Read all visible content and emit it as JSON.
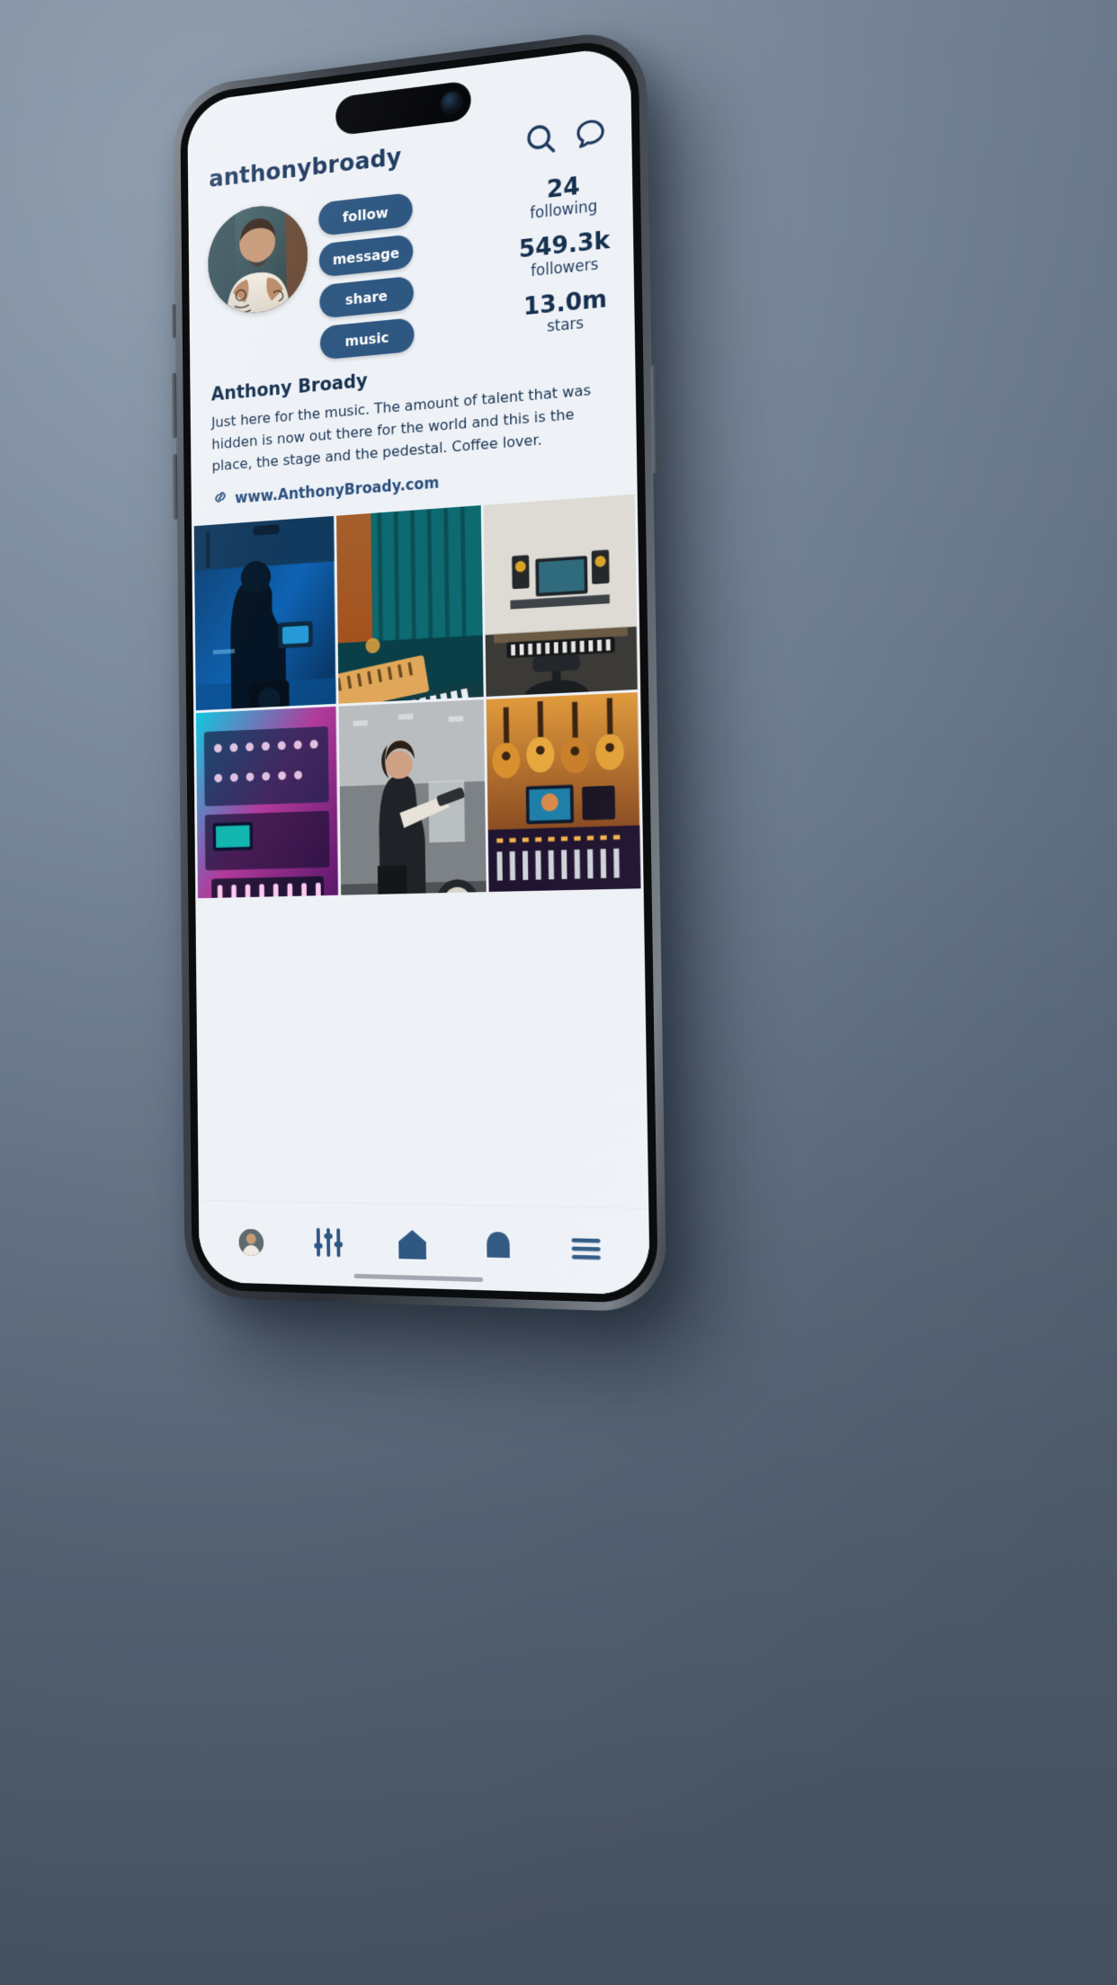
{
  "app": {
    "background_color": "#eef2f7",
    "accent_color": "#2e5781",
    "text_color": "#16304f"
  },
  "header": {
    "username": "anthonybroady",
    "icons": [
      {
        "name": "search-icon",
        "label": "Search"
      },
      {
        "name": "message-icon",
        "label": "Messages"
      }
    ]
  },
  "profile": {
    "avatar_alt": "profile-photo",
    "display_name": "Anthony Broady",
    "bio": "Just here for the music. The amount of talent that was hidden is now out there for the world and this is the place, the stage and the pedestal. Coffee lover.",
    "link": {
      "icon": "link-icon",
      "text": "www.AnthonyBroady.com"
    },
    "actions": [
      {
        "name": "follow-button",
        "label": "follow"
      },
      {
        "name": "message-button",
        "label": "message"
      },
      {
        "name": "share-button",
        "label": "share"
      },
      {
        "name": "music-button",
        "label": "music"
      }
    ],
    "stats": [
      {
        "name": "following-stat",
        "value": "24",
        "label": "following"
      },
      {
        "name": "followers-stat",
        "value": "549.3k",
        "label": "followers"
      },
      {
        "name": "stars-stat",
        "value": "13.0m",
        "label": "stars"
      }
    ]
  },
  "grid": {
    "posts": [
      {
        "name": "post-thumbnail-1",
        "alt": "videographer filming in blue-lit studio"
      },
      {
        "name": "post-thumbnail-2",
        "alt": "keyboard and controller on teal-lit desk"
      },
      {
        "name": "post-thumbnail-3",
        "alt": "home studio desk with monitors and keyboard"
      },
      {
        "name": "post-thumbnail-4",
        "alt": "modular synth rack in neon pink and cyan"
      },
      {
        "name": "post-thumbnail-5",
        "alt": "singer with guitar on rehearsal stage"
      },
      {
        "name": "post-thumbnail-6",
        "alt": "guitars on wall above mixing console"
      }
    ]
  },
  "tabbar": {
    "items": [
      {
        "name": "tab-profile",
        "icon": "avatar-icon",
        "label": "Profile"
      },
      {
        "name": "tab-mixer",
        "icon": "sliders-icon",
        "label": "Mixer"
      },
      {
        "name": "tab-home",
        "icon": "home-icon",
        "label": "Home"
      },
      {
        "name": "tab-alerts",
        "icon": "bell-icon",
        "label": "Alerts"
      },
      {
        "name": "tab-menu",
        "icon": "hamburger-icon",
        "label": "Menu"
      }
    ]
  }
}
